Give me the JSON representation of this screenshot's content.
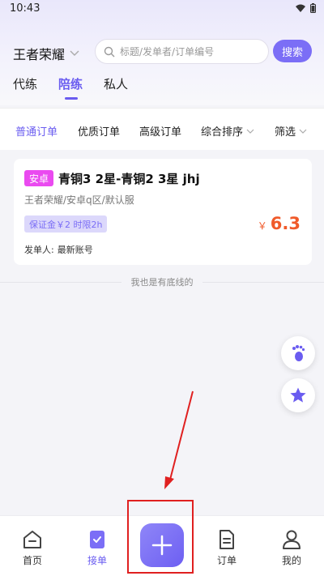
{
  "status_bar": {
    "time": "10:43"
  },
  "header": {
    "game": "王者荣耀",
    "search_placeholder": "标题/发单者/订单编号",
    "search_button": "搜索"
  },
  "main_tabs": [
    {
      "label": "代练",
      "active": false
    },
    {
      "label": "陪练",
      "active": true
    },
    {
      "label": "私人",
      "active": false
    }
  ],
  "filters": [
    {
      "label": "普通订单",
      "active": true
    },
    {
      "label": "优质订单",
      "active": false
    },
    {
      "label": "高级订单",
      "active": false
    },
    {
      "label": "综合排序",
      "active": false
    },
    {
      "label": "筛选",
      "active": false
    }
  ],
  "order": {
    "platform": "安卓",
    "title": "青铜3 2星-青铜2 3星 jhj",
    "subtitle": "王者荣耀/安卓q区/默认服",
    "deposit": "保证金￥2 时限2h",
    "price_symbol": "￥",
    "price": "6.3",
    "publisher_label": "发单人:",
    "publisher_name": "最新账号"
  },
  "list_end_text": "我也是有底线的",
  "bottom_nav": [
    {
      "label": "首页",
      "icon": "home-icon",
      "active": false
    },
    {
      "label": "接单",
      "icon": "accept-order-icon",
      "active": true
    },
    {
      "label": "订单",
      "icon": "order-document-icon",
      "active": false
    },
    {
      "label": "我的",
      "icon": "profile-icon",
      "active": false
    }
  ],
  "colors": {
    "accent": "#6a5cf0",
    "price": "#f05a2a",
    "platform_badge": "#ea4af0",
    "annotation": "#e02020"
  }
}
